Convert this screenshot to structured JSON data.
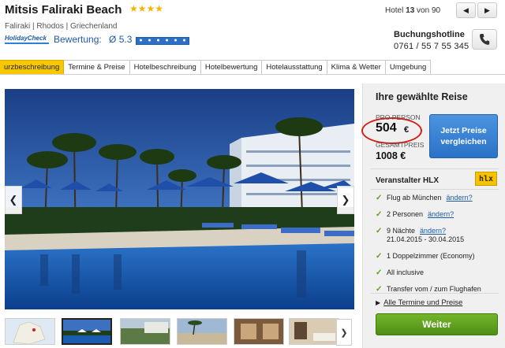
{
  "hotel": {
    "name": "Mitsis Faliraki Beach",
    "stars": "★★★★",
    "location": "Faliraki | Rhodos | Griechenland"
  },
  "rating": {
    "provider_logo_text": "HolidayCheck",
    "label": "Bewertung:",
    "value": "Ø 5.3",
    "suns": "★★★★★★"
  },
  "ranking": {
    "prefix": "Hotel",
    "rank": "13",
    "suffix": "von 90",
    "prev_glyph": "◀",
    "next_glyph": "▶"
  },
  "hotline": {
    "label": "Buchungshotline",
    "number": "0761 / 55 7 55 345",
    "icon": "phone-icon"
  },
  "tabs": [
    {
      "label": "urzbeschreibung",
      "active": true
    },
    {
      "label": "Termine & Preise"
    },
    {
      "label": "Hotelbeschreibung"
    },
    {
      "label": "Hotelbewertung"
    },
    {
      "label": "Hotelausstattung"
    },
    {
      "label": "Klima & Wetter"
    },
    {
      "label": "Umgebung"
    }
  ],
  "gallery": {
    "prev_glyph": "❮",
    "next_glyph": "❯",
    "thumb_next_glyph": "❯"
  },
  "booking": {
    "title": "Ihre gewählte Reise",
    "per_person_label": "PRO PERSON",
    "per_person_price": "504",
    "currency": "€",
    "total_label": "GESAMTPREIS",
    "total_price": "1008 €",
    "compare_button": "Jetzt Preise vergleichen",
    "operator": "Veranstalter HLX",
    "operator_logo": "hlx",
    "features": {
      "flight": "Flug ab München",
      "persons": "2 Personen",
      "nights": "9 Nächte",
      "dates": "21.04.2015 - 30.04.2015",
      "room": "1 Doppelzimmer (Economy)",
      "board": "All inclusive",
      "transfer": "Transfer vom / zum Flughafen"
    },
    "change_link": "ändern?",
    "all_dates_link": "Alle Termine und Preise",
    "continue_button": "Weiter"
  },
  "colors": {
    "accent_blue": "#2b72c8",
    "tab_active": "#f7c800",
    "cta_green": "#5b9e1c",
    "highlight_red": "#d41f17",
    "check_green": "#58a51a"
  }
}
